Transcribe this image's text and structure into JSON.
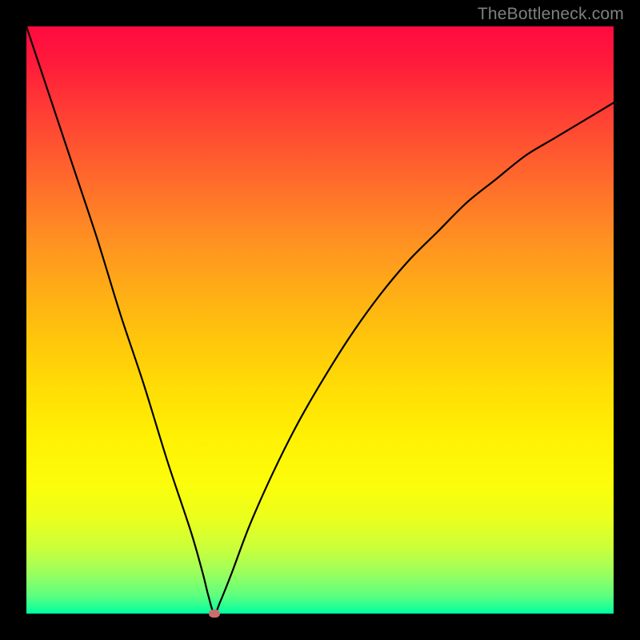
{
  "watermark": "TheBottleneck.com",
  "colors": {
    "background": "#000000",
    "gradient_top": "#ff0a40",
    "gradient_bottom": "#00ffa2",
    "curve": "#000000",
    "marker": "#cc6d6d"
  },
  "chart_data": {
    "type": "line",
    "title": "",
    "xlabel": "",
    "ylabel": "",
    "xlim": [
      0,
      100
    ],
    "ylim": [
      0,
      100
    ],
    "annotations": [
      "TheBottleneck.com"
    ],
    "marker": {
      "x": 32,
      "y": 0
    },
    "series": [
      {
        "name": "bottleneck-curve",
        "x": [
          0,
          4,
          8,
          12,
          16,
          20,
          24,
          28,
          30,
          31,
          32,
          33,
          35,
          38,
          42,
          46,
          50,
          55,
          60,
          65,
          70,
          75,
          80,
          85,
          90,
          95,
          100
        ],
        "y": [
          100,
          88,
          76,
          64,
          51,
          39,
          26,
          14,
          7,
          3,
          0,
          2,
          7,
          15,
          24,
          32,
          39,
          47,
          54,
          60,
          65,
          70,
          74,
          78,
          81,
          84,
          87
        ]
      }
    ]
  }
}
